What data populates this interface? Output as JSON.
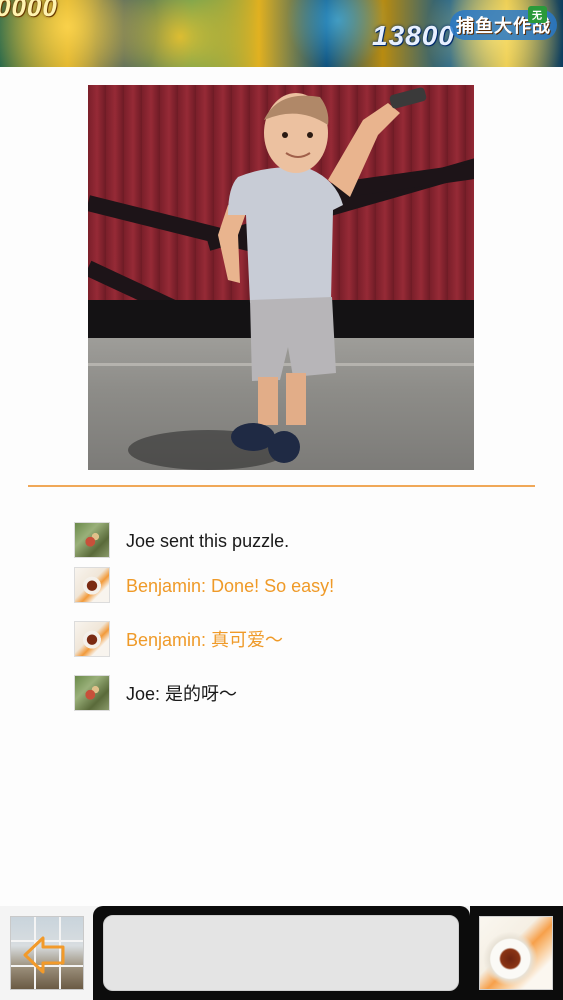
{
  "banner": {
    "texts": [
      "0000",
      "13800",
      "捕鱼大作战",
      "无"
    ]
  },
  "photo": {
    "subject": "toddler holding a remote on a stage"
  },
  "messages": [
    {
      "avatar": "joe",
      "text": "Joe sent this puzzle.",
      "color": "#1a1a1a"
    },
    {
      "avatar": "benjamin",
      "text": "Benjamin: Done! So easy!",
      "color": "#ef9a28"
    },
    {
      "avatar": "benjamin",
      "text": "Benjamin: 真可爱～",
      "color": "#ef9a28"
    },
    {
      "avatar": "joe",
      "text": "Joe: 是的呀～",
      "color": "#1a1a1a"
    }
  ],
  "composer": {
    "value": ""
  },
  "colors": {
    "accent": "#ef9a28",
    "separator": "#f0a858"
  }
}
